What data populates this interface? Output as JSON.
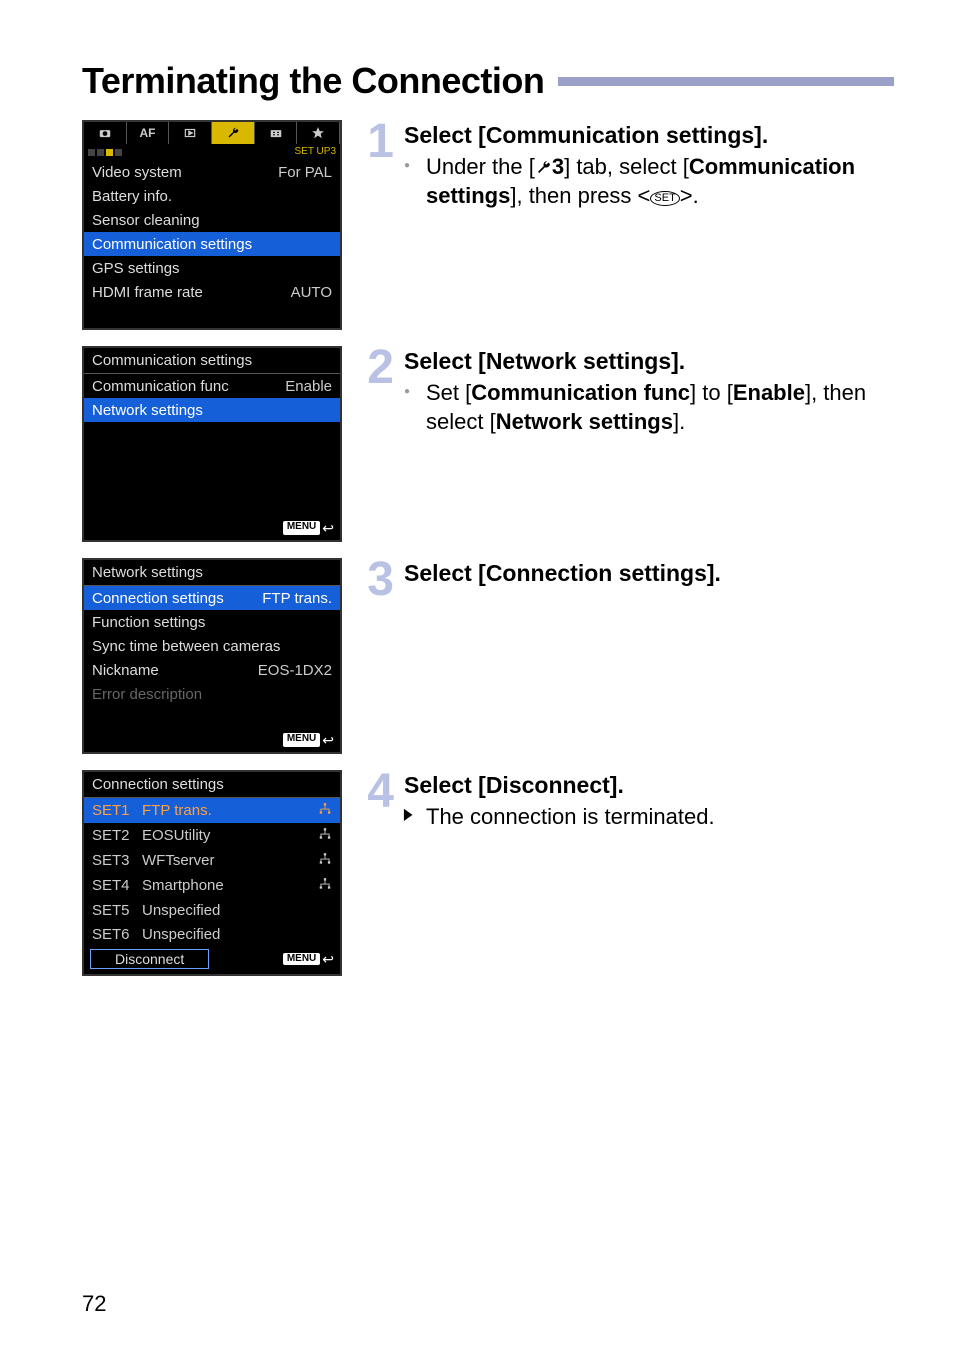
{
  "page": {
    "title": "Terminating the Connection",
    "page_number": "72"
  },
  "steps": [
    {
      "number": "1",
      "heading": "Select [Communication settings].",
      "body_pre": "Under the [",
      "wrench_label": "3",
      "body_mid": "] tab, select [",
      "bold": "Communication settings",
      "body_after": "], then press <",
      "set_label": "SET",
      "body_end": ">."
    },
    {
      "number": "2",
      "heading": "Select [Network settings].",
      "body_pre": "Set [",
      "bold1": "Communication func",
      "body_mid": "] to [",
      "bold2": "Enable",
      "body_mid2": "], then select [",
      "bold3": "Network settings",
      "body_end": "]."
    },
    {
      "number": "3",
      "heading": "Select [Connection settings]."
    },
    {
      "number": "4",
      "heading": "Select [Disconnect].",
      "arrow_text": "The connection is terminated."
    }
  ],
  "lcd1": {
    "tabs": [
      "camera",
      "AF",
      "play",
      "wrench",
      "custom",
      "star"
    ],
    "sub_label": "SET UP3",
    "rows": [
      {
        "k": "Video system",
        "v": "For PAL"
      },
      {
        "k": "Battery info.",
        "v": ""
      },
      {
        "k": "Sensor cleaning",
        "v": ""
      },
      {
        "k": "Communication settings",
        "v": "",
        "sel": true
      },
      {
        "k": "GPS settings",
        "v": ""
      },
      {
        "k": "HDMI frame rate",
        "v": "AUTO"
      }
    ]
  },
  "lcd2": {
    "title": "Communication settings",
    "rows": [
      {
        "k": "Communication func",
        "v": "Enable"
      },
      {
        "k": "Network settings",
        "v": "",
        "sel": true
      }
    ],
    "menu": "MENU"
  },
  "lcd3": {
    "title": "Network settings",
    "rows": [
      {
        "k": "Connection settings",
        "v": "FTP trans.",
        "sel": true
      },
      {
        "k": "Function settings",
        "v": ""
      },
      {
        "k": "Sync time between cameras",
        "v": ""
      },
      {
        "k": "Nickname",
        "v": "EOS-1DX2"
      },
      {
        "k": "Error description",
        "v": "",
        "disabled": true
      }
    ],
    "menu": "MENU"
  },
  "lcd4": {
    "title": "Connection settings",
    "rows": [
      {
        "k": "SET1",
        "v": "FTP trans.",
        "sel": true,
        "icon": true,
        "icon_orange": true
      },
      {
        "k": "SET2",
        "v": "EOSUtility",
        "icon": true
      },
      {
        "k": "SET3",
        "v": "WFTserver",
        "icon": true
      },
      {
        "k": "SET4",
        "v": "Smartphone",
        "icon": true
      },
      {
        "k": "SET5",
        "v": "Unspecified"
      },
      {
        "k": "SET6",
        "v": "Unspecified"
      }
    ],
    "disconnect": "Disconnect",
    "menu": "MENU"
  }
}
